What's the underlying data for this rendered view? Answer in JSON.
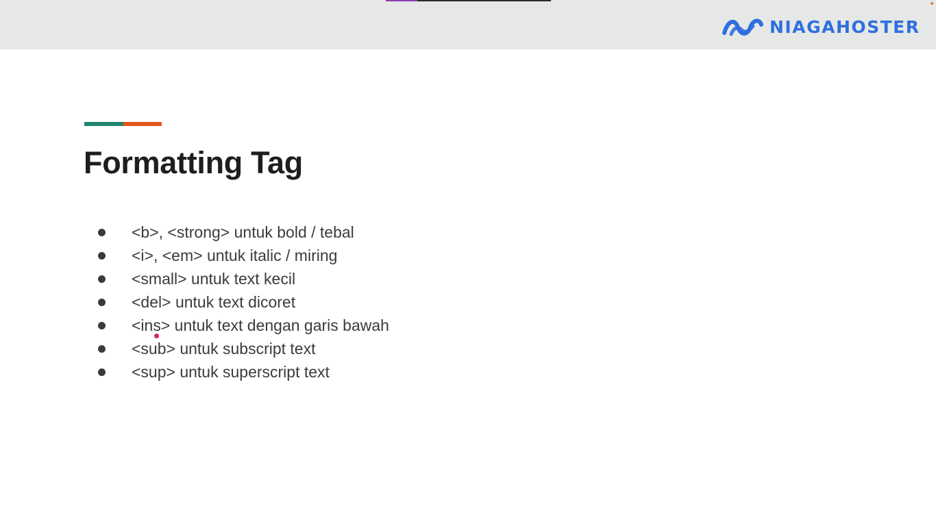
{
  "brand": {
    "name": "NIAGAHOSTER",
    "color": "#2f6fe0"
  },
  "slide": {
    "title": "Formatting Tag",
    "accent_colors": [
      "#22866f",
      "#e0581e"
    ],
    "bullets": [
      "<b>, <strong> untuk bold / tebal",
      "<i>, <em> untuk italic / miring",
      "<small> untuk text kecil",
      "<del> untuk text dicoret",
      "<ins> untuk text dengan garis bawah",
      "<sub> untuk subscript text",
      "<sup> untuk superscript text"
    ]
  },
  "icons": {
    "logo": "niagahoster-wave-icon",
    "bullet": "bullet-dot-icon",
    "pointer": "pointer-dot-icon"
  }
}
